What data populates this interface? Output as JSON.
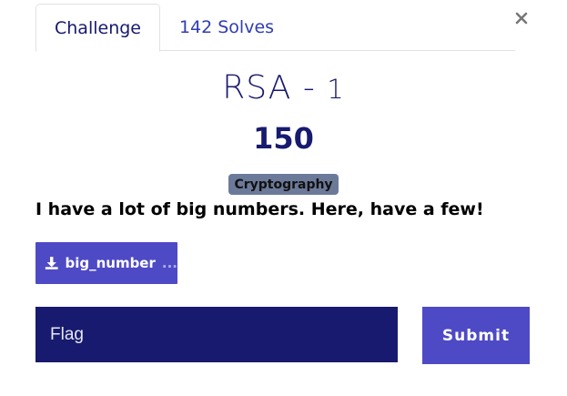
{
  "close": {
    "icon": "close-icon",
    "glyph": "×"
  },
  "tabs": [
    {
      "label": "Challenge",
      "active": true
    },
    {
      "label": "142 Solves",
      "active": false
    }
  ],
  "challenge": {
    "name": "RSA - ",
    "name_suffix": "1",
    "value": "150",
    "category": "Cryptography",
    "description": "I have a lot of big numbers. Here, have a few!",
    "file": {
      "icon": "download-icon",
      "name": "big_number",
      "ellipsis": "..."
    }
  },
  "form": {
    "flag_placeholder": "Flag",
    "submit_label": "Submit"
  },
  "colors": {
    "primary_dark": "#171a6e",
    "primary": "#4e4ac5",
    "tab_link": "#2f3db3",
    "badge_bg": "#6c7a99"
  }
}
